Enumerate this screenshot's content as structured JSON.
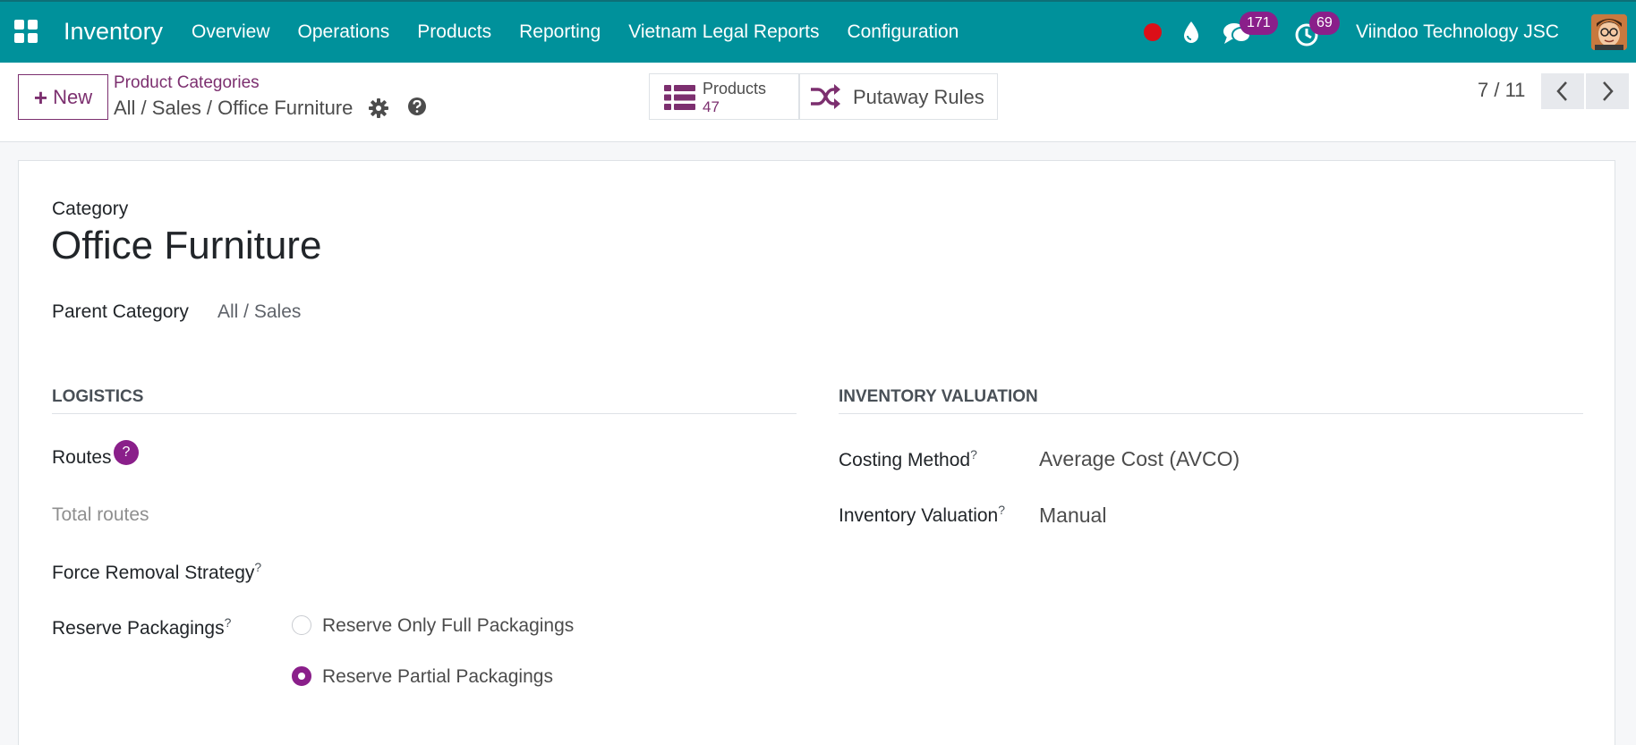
{
  "navbar": {
    "app_name": "Inventory",
    "menu": [
      "Overview",
      "Operations",
      "Products",
      "Reporting",
      "Vietnam Legal Reports",
      "Configuration"
    ],
    "messages_count": "171",
    "activities_count": "69",
    "company": "Viindoo Technology JSC",
    "icons": [
      "apps-grid-icon",
      "record-dot-icon",
      "water-drop-icon",
      "chat-icon",
      "clock-icon",
      "user-avatar"
    ]
  },
  "control": {
    "new_label": "New",
    "breadcrumb_parent": "Product Categories",
    "breadcrumb_current": "All / Sales / Office Furniture",
    "smart_products_label": "Products",
    "smart_products_count": "47",
    "putaway_label": "Putaway Rules",
    "pager": "7 / 11"
  },
  "form": {
    "category_label": "Category",
    "category_name": "Office Furniture",
    "parent_label": "Parent Category",
    "parent_value": "All / Sales",
    "logistics": {
      "title": "LOGISTICS",
      "routes_label": "Routes",
      "routes_help": "?",
      "total_routes": "Total routes",
      "force_removal_label": "Force Removal Strategy",
      "reserve_label": "Reserve Packagings",
      "reserve_options": [
        "Reserve Only Full Packagings",
        "Reserve Partial Packagings"
      ],
      "reserve_selected": "Reserve Partial Packagings"
    },
    "valuation": {
      "title": "INVENTORY VALUATION",
      "costing_label": "Costing Method",
      "costing_value": "Average Cost (AVCO)",
      "valuation_label": "Inventory Valuation",
      "valuation_value": "Manual"
    },
    "help_mark": "?"
  },
  "colors": {
    "navbar": "#00919b",
    "primary": "#7c2f6f",
    "badge": "#8a1f8a",
    "record": "#dc0f18"
  }
}
